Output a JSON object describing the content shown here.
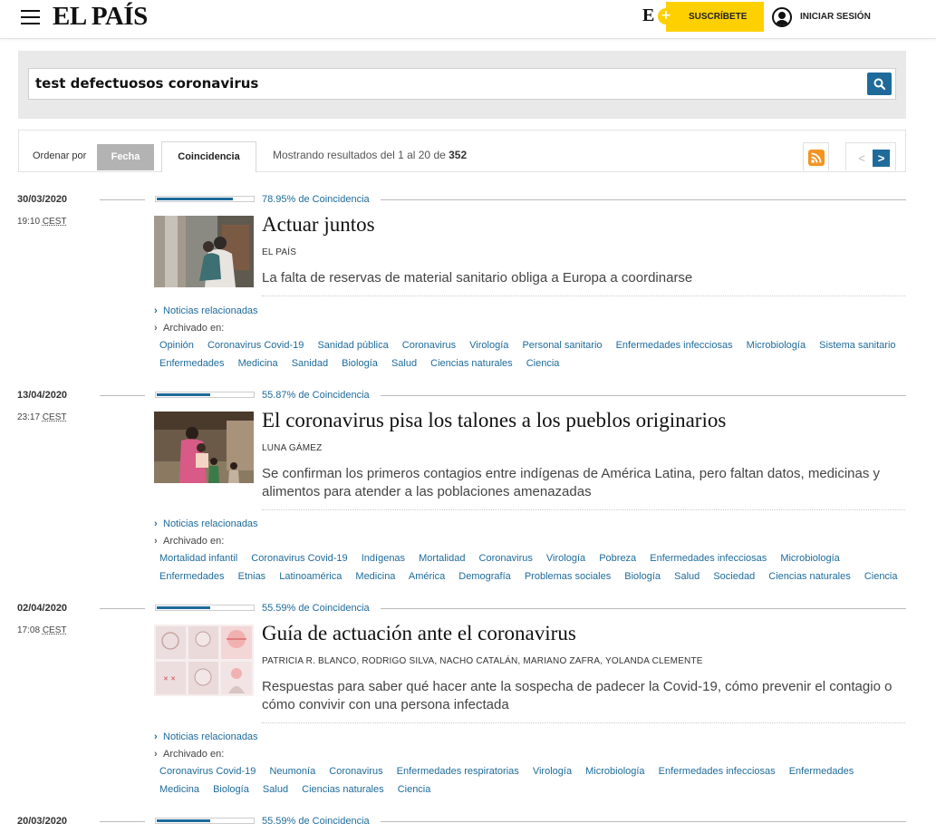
{
  "header": {
    "logo": "EL PAÍS",
    "eplus": "E",
    "eplus_sign": "+",
    "subscribe_label": "SUSCRÍBETE",
    "login_label": "INICIAR SESIÓN"
  },
  "search": {
    "query": "test defectuosos coronavirus"
  },
  "sort": {
    "label": "Ordenar por",
    "options": [
      "Fecha",
      "Coincidencia"
    ],
    "results_prefix": "Mostrando resultados del 1 al 20 de ",
    "results_total": "352",
    "prev": "<",
    "next": ">"
  },
  "colors": {
    "accent": "#1e6b9b",
    "subscribe": "#ffd000",
    "rss": "#f29420"
  },
  "results": [
    {
      "date": "30/03/2020",
      "time": "19:10",
      "tz": "CEST",
      "score": "78.95%",
      "score_fraction": 0.7895,
      "score_suffix": " de Coincidencia",
      "title": "Actuar juntos",
      "author": "EL PAÍS",
      "summary": "La falta de reservas de material sanitario obliga a Europa a coordinarse",
      "related": "Noticias relacionadas",
      "archived": "Archivado en:",
      "tags": [
        "Opinión",
        "Coronavirus Covid-19",
        "Sanidad pública",
        "Coronavirus",
        "Virología",
        "Personal sanitario",
        "Enfermedades infecciosas",
        "Microbiología",
        "Sistema sanitario",
        "Enfermedades",
        "Medicina",
        "Sanidad",
        "Biología",
        "Salud",
        "Ciencias naturales",
        "Ciencia"
      ]
    },
    {
      "date": "13/04/2020",
      "time": "23:17",
      "tz": "CEST",
      "score": "55.87%",
      "score_fraction": 0.5587,
      "score_suffix": " de Coincidencia",
      "title": "El coronavirus pisa los talones a los pueblos originarios",
      "author": "LUNA GÁMEZ",
      "summary": "Se confirman los primeros contagios entre indígenas de América Latina, pero faltan datos, medicinas y alimentos para atender a las poblaciones amenazadas",
      "related": "Noticias relacionadas",
      "archived": "Archivado en:",
      "tags": [
        "Mortalidad infantil",
        "Coronavirus Covid-19",
        "Indígenas",
        "Mortalidad",
        "Coronavirus",
        "Virología",
        "Pobreza",
        "Enfermedades infecciosas",
        "Microbiología",
        "Enfermedades",
        "Etnias",
        "Latinoamérica",
        "Medicina",
        "América",
        "Demografía",
        "Problemas sociales",
        "Biología",
        "Salud",
        "Sociedad",
        "Ciencias naturales",
        "Ciencia"
      ]
    },
    {
      "date": "02/04/2020",
      "time": "17:08",
      "tz": "CEST",
      "score": "55.59%",
      "score_fraction": 0.5559,
      "score_suffix": " de Coincidencia",
      "title": "Guía de actuación ante el coronavirus",
      "author": "PATRICIA R. BLANCO, RODRIGO SILVA, NACHO CATALÁN, MARIANO ZAFRA, YOLANDA CLEMENTE",
      "summary": "Respuestas para saber qué hacer ante la sospecha de padecer la Covid-19, cómo prevenir el contagio o cómo convivir con una persona infectada",
      "related": "Noticias relacionadas",
      "archived": "Archivado en:",
      "tags": [
        "Coronavirus Covid-19",
        "Neumonía",
        "Coronavirus",
        "Enfermedades respiratorias",
        "Virología",
        "Microbiología",
        "Enfermedades infecciosas",
        "Enfermedades",
        "Medicina",
        "Biología",
        "Salud",
        "Ciencias naturales",
        "Ciencia"
      ]
    },
    {
      "date": "20/03/2020",
      "score": "55.59%",
      "score_fraction": 0.5559,
      "score_suffix": " de Coincidencia"
    }
  ]
}
